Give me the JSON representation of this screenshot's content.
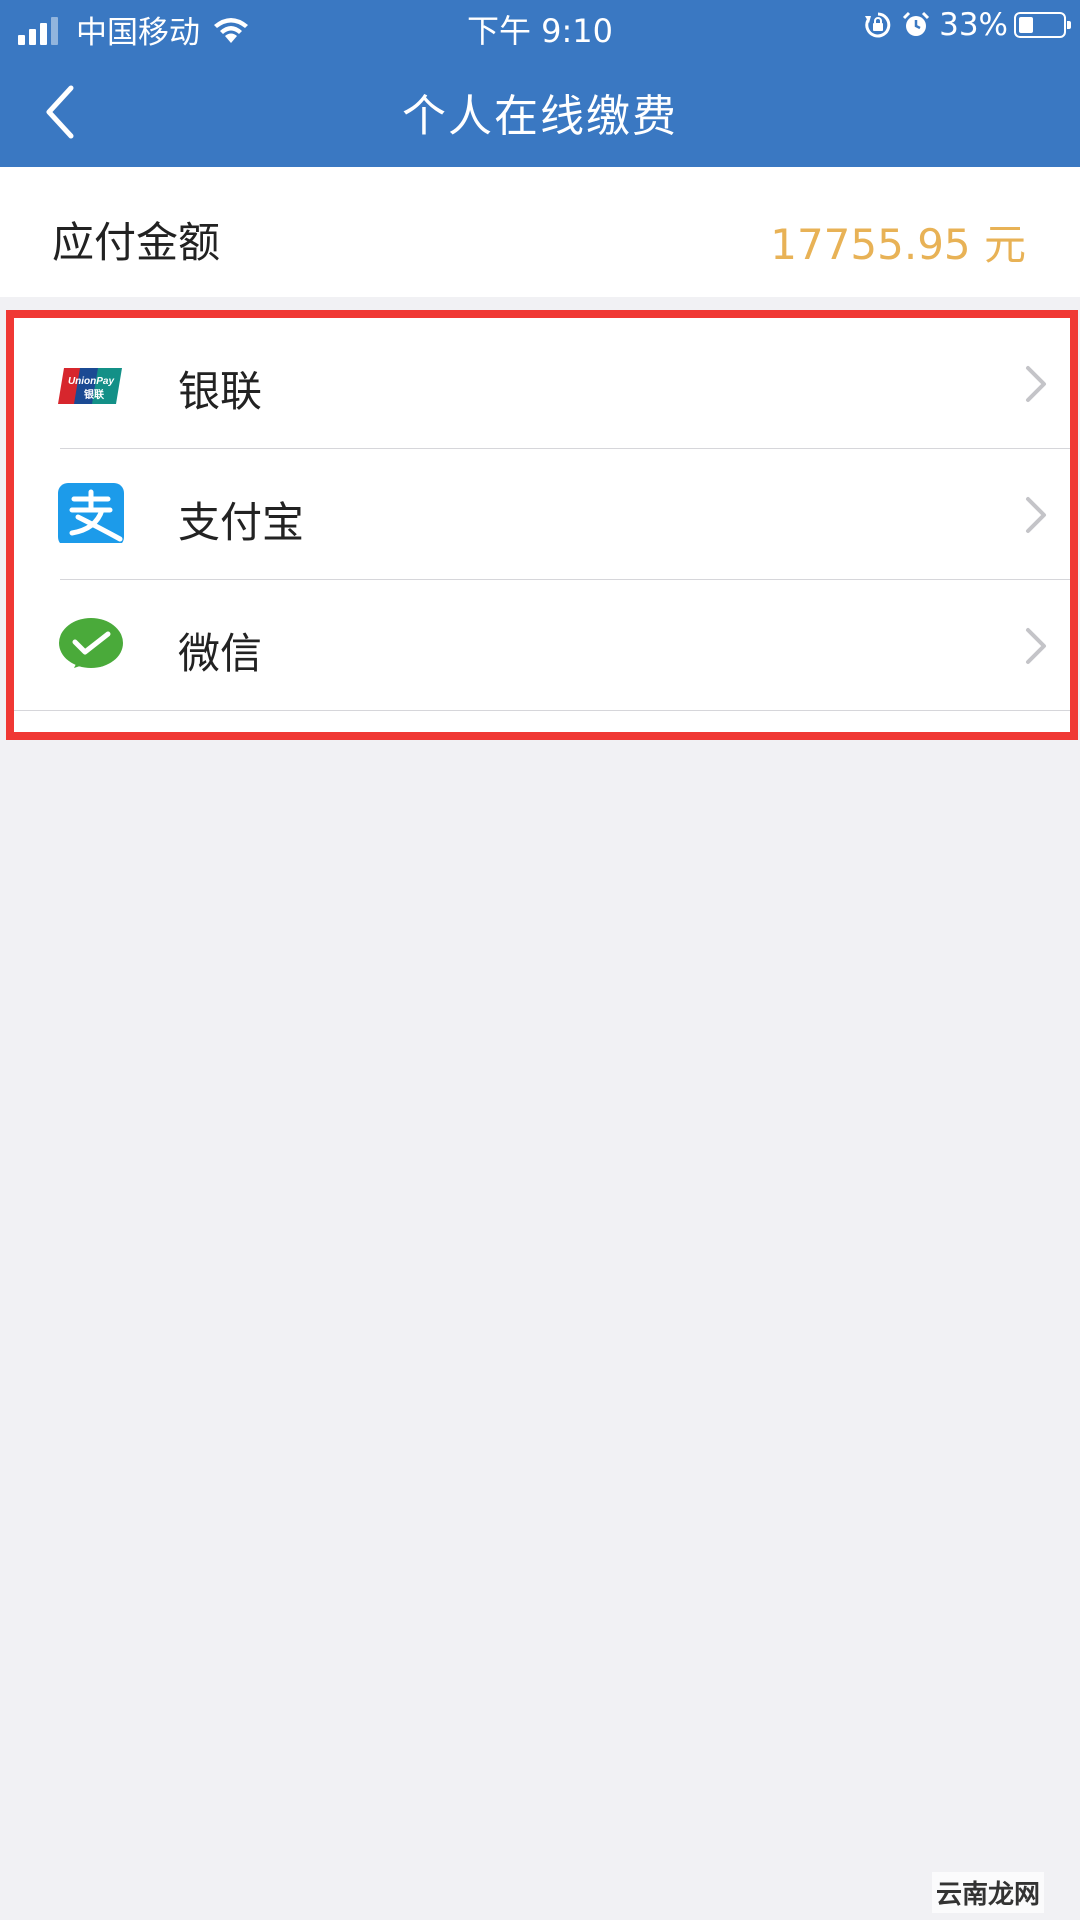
{
  "status_bar": {
    "carrier": "中国移动",
    "time": "下午 9:10",
    "battery_percent": "33%",
    "battery_level": 0.33,
    "icons": [
      "signal-icon",
      "wifi-icon",
      "orientation-lock-icon",
      "alarm-icon",
      "battery-icon"
    ]
  },
  "header": {
    "title": "个人在线缴费",
    "back_icon": "chevron-left-icon",
    "background": "#3a78c2"
  },
  "amount": {
    "label": "应付金额",
    "value": "17755.95 元",
    "value_color": "#e8b256"
  },
  "payment_methods": [
    {
      "label": "银联",
      "icon": "unionpay-icon"
    },
    {
      "label": "支付宝",
      "icon": "alipay-icon"
    },
    {
      "label": "微信",
      "icon": "wechat-pay-icon"
    }
  ],
  "highlight_color": "#f03834",
  "watermark": "云南龙网"
}
